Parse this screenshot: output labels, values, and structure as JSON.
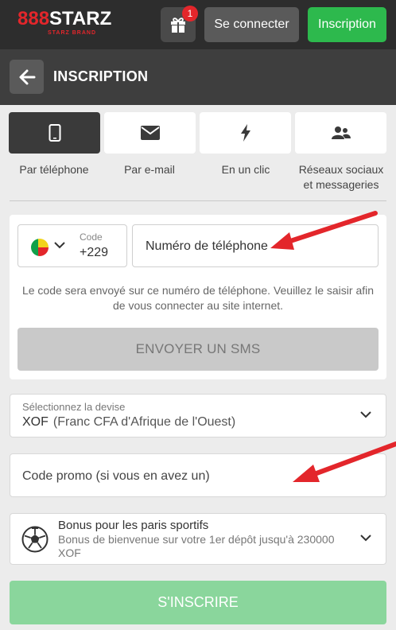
{
  "header": {
    "logo_main": "888STARZ",
    "logo_sub": "STARZ BRAND",
    "gift_badge": "1",
    "login_label": "Se connecter",
    "signup_label": "Inscription"
  },
  "title_bar": {
    "title": "INSCRIPTION"
  },
  "methods": [
    {
      "label": "Par téléphone",
      "icon": "smartphone-icon",
      "active": true
    },
    {
      "label": "Par e-mail",
      "icon": "envelope-icon",
      "active": false
    },
    {
      "label": "En un clic",
      "icon": "lightning-icon",
      "active": false
    },
    {
      "label": "Réseaux sociaux et messageries",
      "icon": "users-icon",
      "active": false
    }
  ],
  "phone_form": {
    "code_label": "Code",
    "code_value": "+229",
    "phone_placeholder": "Numéro de téléphone",
    "hint": "Le code sera envoyé sur ce numéro de téléphone. Veuillez le saisir afin de vous connecter au site internet.",
    "sms_button": "ENVOYER UN SMS"
  },
  "currency": {
    "label": "Sélectionnez la devise",
    "code": "XOF",
    "name": "(Franc CFA d'Afrique de l'Ouest)"
  },
  "promo": {
    "placeholder": "Code promo (si vous en avez un)"
  },
  "bonus": {
    "title": "Bonus pour les paris sportifs",
    "description": "Bonus de bienvenue sur votre 1er dépôt jusqu'à 230000 XOF"
  },
  "submit_label": "S'INSCRIRE",
  "colors": {
    "brand_red": "#e3262b",
    "accent_green": "#2db94d",
    "disabled_green": "#8ad69c",
    "annotation_arrow": "#e3262b"
  }
}
